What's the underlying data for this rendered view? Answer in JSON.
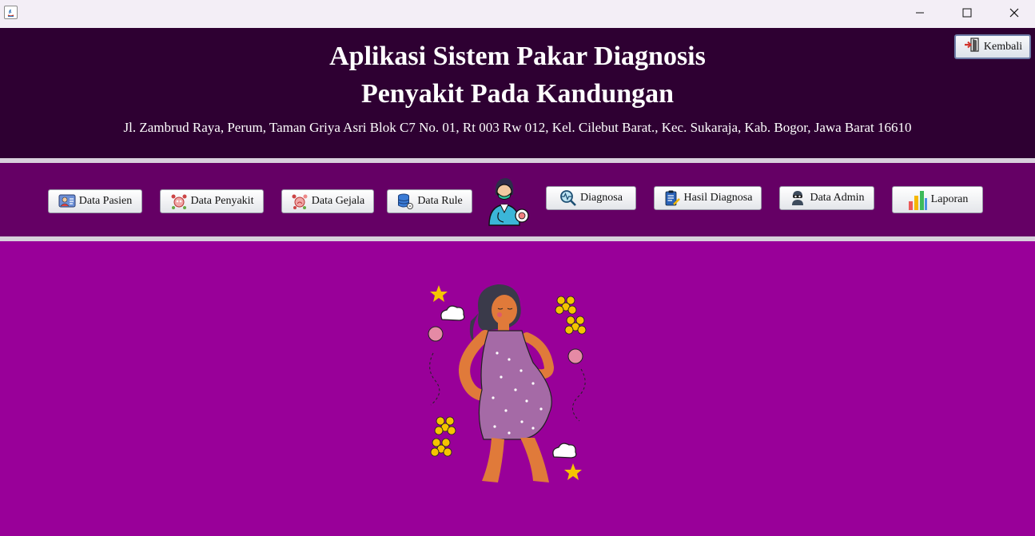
{
  "window": {
    "minimize_label": "—",
    "maximize_label": "☐",
    "close_label": "✕"
  },
  "header": {
    "title_line1": "Aplikasi Sistem Pakar Diagnosis",
    "title_line2": "Penyakit Pada Kandungan",
    "address": "Jl. Zambrud Raya, Perum, Taman Griya Asri Blok C7 No. 01, Rt 003 Rw 012, Kel. Cilebut Barat., Kec. Sukaraja, Kab. Bogor, Jawa Barat 16610",
    "back_button": "Kembali"
  },
  "menu": {
    "data_pasien": "Data Pasien",
    "data_penyakit": "Data Penyakit",
    "data_gejala": "Data Gejala",
    "data_rule": "Data Rule",
    "diagnosa": "Diagnosa",
    "hasil_diagnosa": "Hasil Diagnosa",
    "data_admin": "Data Admin",
    "laporan": "Laporan"
  },
  "colors": {
    "header_bg": "#2e0032",
    "menubar_bg": "#650065",
    "content_bg": "#990099"
  },
  "icons": [
    "java-app-icon",
    "exit-door-icon",
    "patient-icon",
    "disease-icon",
    "symptom-icon",
    "database-icon",
    "doctor-icon",
    "diagnosis-icon",
    "clipboard-icon",
    "admin-icon",
    "bar-chart-icon",
    "pregnant-woman-illustration"
  ]
}
